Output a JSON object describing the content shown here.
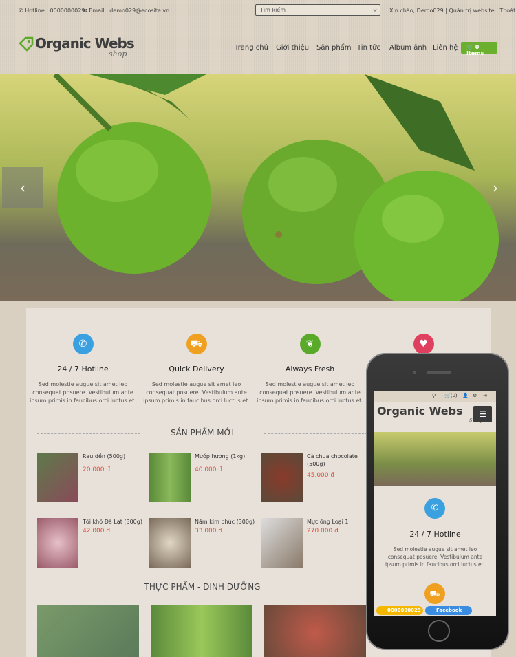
{
  "topbar": {
    "hotline": "Hotline : 0000000029",
    "email": "Email : demo029@ecosite.vn",
    "search_placeholder": "Tìm kiếm",
    "user": "Xin chào, Demo029 | Quản trị website | Thoát"
  },
  "logo": {
    "main": "Organic Webs",
    "sub": "shop"
  },
  "nav": [
    "Trang chủ",
    "Giới thiệu",
    "Sản phẩm",
    "Tin tức",
    "Album ảnh",
    "Liên hệ"
  ],
  "cart": "0 Items",
  "features": [
    {
      "title": "24 / 7 Hotline",
      "text": "Sed molestie augue sit amet leo consequat posuere. Vestibulum ante ipsum primis in faucibus orci luctus et.",
      "icon": "phone-icon",
      "color": "#3aa0e0"
    },
    {
      "title": "Quick Delivery",
      "text": "Sed molestie augue sit amet leo consequat posuere. Vestibulum ante ipsum primis in faucibus orci luctus et.",
      "icon": "truck-icon",
      "color": "#f0a020"
    },
    {
      "title": "Always Fresh",
      "text": "Sed molestie augue sit amet leo consequat posuere. Vestibulum ante ipsum primis in faucibus orci luctus et.",
      "icon": "leaf-icon",
      "color": "#5aaa2a"
    },
    {
      "title": "",
      "text": "",
      "icon": "heart-icon",
      "color": "#e04060"
    }
  ],
  "section_new": "SẢN PHẨM MỚI",
  "products": [
    {
      "name": "Rau dền (500g)",
      "price": "20.000 đ"
    },
    {
      "name": "Mướp hương (1kg)",
      "price": "40.000 đ"
    },
    {
      "name": "Cà chua chocolate (500g)",
      "price": "45.000 đ"
    },
    {
      "name": "Tỏi khô Đà Lạt (300g)",
      "price": "42.000 đ"
    },
    {
      "name": "Nấm kim phúc (300g)",
      "price": "33.000 đ"
    },
    {
      "name": "Mực ống Loại 1",
      "price": "270.000 đ"
    }
  ],
  "section_food": "THỰC PHẨM - DINH DƯỠNG",
  "mobile": {
    "cart": "(0)",
    "title": "24 / 7 Hotline",
    "text": "Sed molestie augue sit amet leo consequat posuere. Vestibulum ante ipsum primis in faucibus orci luctus et.",
    "hotline": "0000000029",
    "facebook": "Facebook"
  }
}
